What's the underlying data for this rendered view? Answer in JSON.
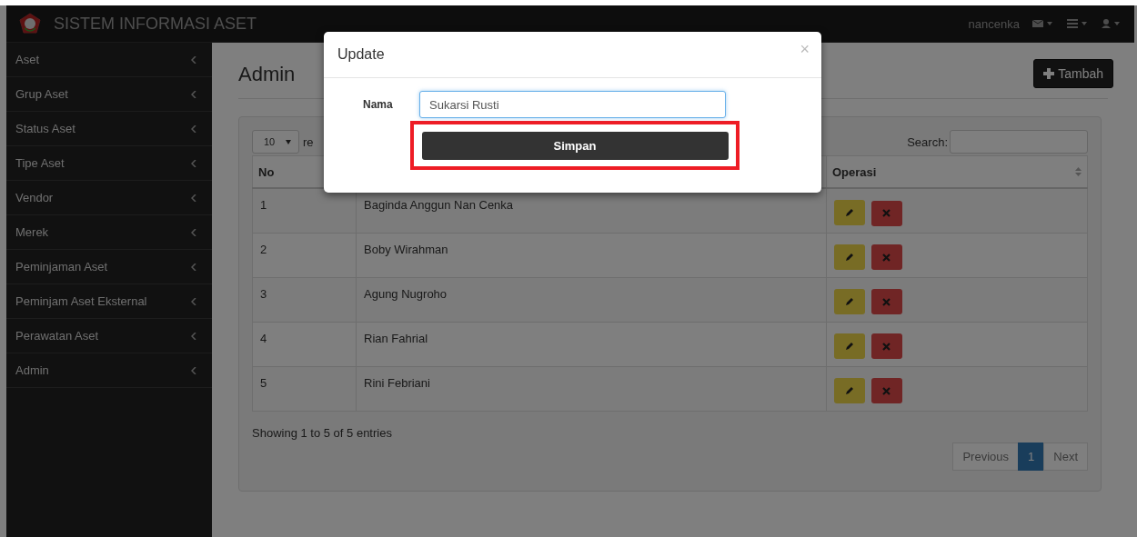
{
  "navbar": {
    "brand": "SISTEM INFORMASI ASET",
    "username": "nancenka"
  },
  "sidebar": {
    "items": [
      {
        "label": "Aset",
        "expanded": false
      },
      {
        "label": "Grup Aset",
        "expanded": false
      },
      {
        "label": "Status Aset",
        "expanded": false
      },
      {
        "label": "Tipe Aset",
        "expanded": false
      },
      {
        "label": "Vendor",
        "expanded": false
      },
      {
        "label": "Merek",
        "expanded": false
      },
      {
        "label": "Peminjaman Aset",
        "expanded": false
      },
      {
        "label": "Peminjam Aset Eksternal",
        "expanded": false
      },
      {
        "label": "Perawatan Aset",
        "expanded": false
      },
      {
        "label": "Admin",
        "expanded": false
      }
    ]
  },
  "page": {
    "title": "Admin",
    "add_button": "Tambah"
  },
  "table_controls": {
    "page_size": "10",
    "page_size_suffix": "re",
    "search_label": "Search:"
  },
  "table": {
    "columns": [
      {
        "label": "No"
      },
      {},
      {
        "label": "Operasi"
      }
    ],
    "rows": [
      {
        "no": "1",
        "name": "Baginda Anggun Nan Cenka"
      },
      {
        "no": "2",
        "name": "Boby Wirahman"
      },
      {
        "no": "3",
        "name": "Agung Nugroho"
      },
      {
        "no": "4",
        "name": "Rian Fahrial"
      },
      {
        "no": "5",
        "name": "Rini Febriani"
      }
    ]
  },
  "info": "Showing 1 to 5 of 5 entries",
  "pagination": [
    {
      "label": "Previous",
      "selected": false
    },
    {
      "label": "1",
      "selected": true
    },
    {
      "label": "Next",
      "selected": false
    }
  ],
  "modal": {
    "title": "Update",
    "field_label": "Nama",
    "field_value": "Sukarsi Rusti",
    "submit": "Simpan",
    "close": "×",
    "highlighted": true
  }
}
